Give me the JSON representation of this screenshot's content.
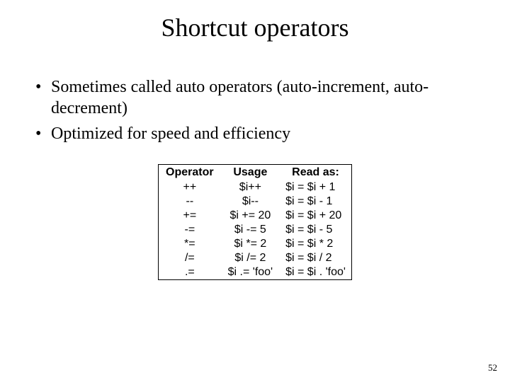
{
  "title": "Shortcut operators",
  "bullets": [
    "Sometimes called auto operators (auto-increment, auto-decrement)",
    "Optimized for speed and efficiency"
  ],
  "table": {
    "headers": {
      "col1": "Operator",
      "col2": "Usage",
      "col3": "Read as:"
    },
    "rows": [
      {
        "op": "++",
        "usage": "$i++",
        "read": "$i = $i + 1"
      },
      {
        "op": "--",
        "usage": "$i--",
        "read": "$i = $i - 1"
      },
      {
        "op": "+=",
        "usage": "$i += 20",
        "read": "$i = $i + 20"
      },
      {
        "op": "-=",
        "usage": "$i -= 5",
        "read": "$i = $i - 5"
      },
      {
        "op": "*=",
        "usage": "$i *= 2",
        "read": "$i = $i * 2"
      },
      {
        "op": "/=",
        "usage": "$i /= 2",
        "read": "$i = $i / 2"
      },
      {
        "op": ".=",
        "usage": "$i .= 'foo'",
        "read": "$i = $i . 'foo'"
      }
    ]
  },
  "pagenum": "52"
}
